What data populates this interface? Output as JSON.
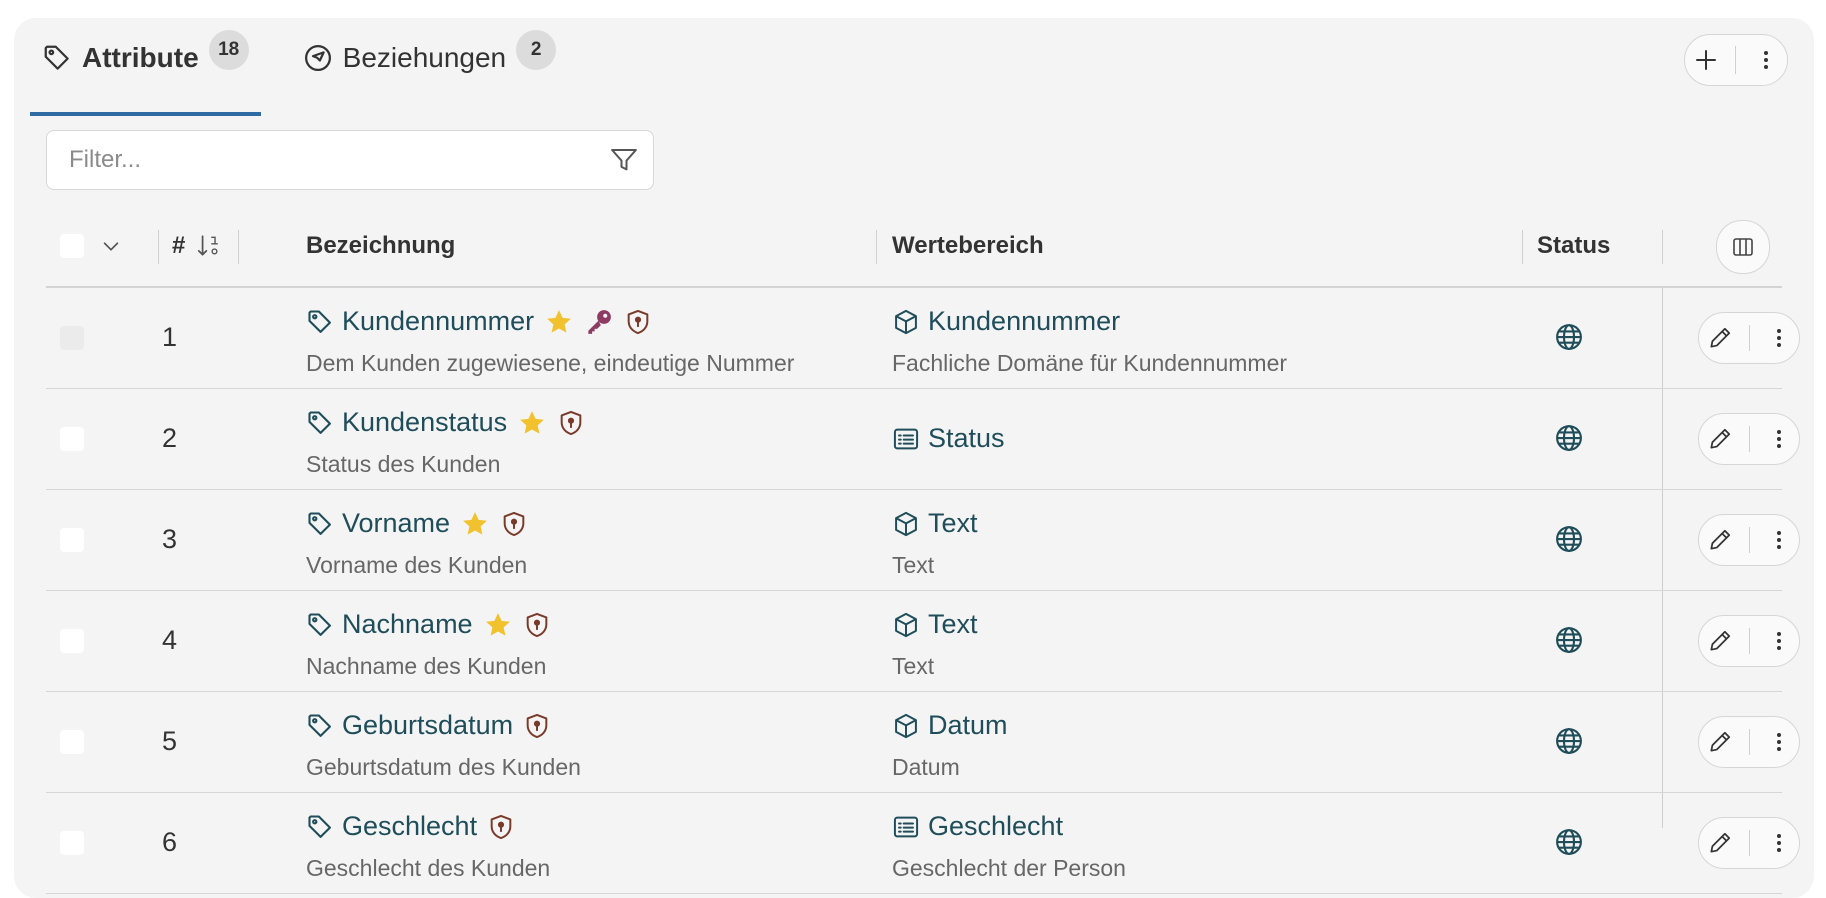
{
  "tabs": [
    {
      "label": "Attribute",
      "count": "18",
      "icon": "tag-icon",
      "active": true
    },
    {
      "label": "Beziehungen",
      "count": "2",
      "icon": "compass-icon",
      "active": false
    }
  ],
  "filter": {
    "placeholder": "Filter..."
  },
  "table": {
    "headers": {
      "number": "#",
      "name": "Bezeichnung",
      "domain": "Wertebereich",
      "status": "Status"
    },
    "rows": [
      {
        "number": "1",
        "name": "Kundennummer",
        "description": "Dem Kunden zugewiesene, eindeutige Nummer",
        "star": true,
        "key": true,
        "shield": true,
        "domain_name": "Kundennummer",
        "domain_icon": "cube-icon",
        "domain_description": "Fachliche Domäne für Kundennummer",
        "status_icon": "globe-icon"
      },
      {
        "number": "2",
        "name": "Kundenstatus",
        "description": "Status des Kunden",
        "star": true,
        "key": false,
        "shield": true,
        "domain_name": "Status",
        "domain_icon": "list-icon",
        "domain_description": "",
        "status_icon": "globe-icon"
      },
      {
        "number": "3",
        "name": "Vorname",
        "description": "Vorname des Kunden",
        "star": true,
        "key": false,
        "shield": true,
        "domain_name": "Text",
        "domain_icon": "cube-icon",
        "domain_description": "Text",
        "status_icon": "globe-icon"
      },
      {
        "number": "4",
        "name": "Nachname",
        "description": "Nachname des Kunden",
        "star": true,
        "key": false,
        "shield": true,
        "domain_name": "Text",
        "domain_icon": "cube-icon",
        "domain_description": "Text",
        "status_icon": "globe-icon"
      },
      {
        "number": "5",
        "name": "Geburtsdatum",
        "description": "Geburtsdatum des Kunden",
        "star": false,
        "key": false,
        "shield": true,
        "domain_name": "Datum",
        "domain_icon": "cube-icon",
        "domain_description": "Datum",
        "status_icon": "globe-icon"
      },
      {
        "number": "6",
        "name": "Geschlecht",
        "description": "Geschlecht des Kunden",
        "star": false,
        "key": false,
        "shield": true,
        "domain_name": "Geschlecht",
        "domain_icon": "list-icon",
        "domain_description": "Geschlecht der Person",
        "status_icon": "globe-icon"
      }
    ]
  },
  "colors": {
    "accent": "#2f6aa3",
    "link": "#1f4d5a",
    "star": "#f2c12e",
    "key": "#8e3b63",
    "shield": "#7a3a2a"
  }
}
